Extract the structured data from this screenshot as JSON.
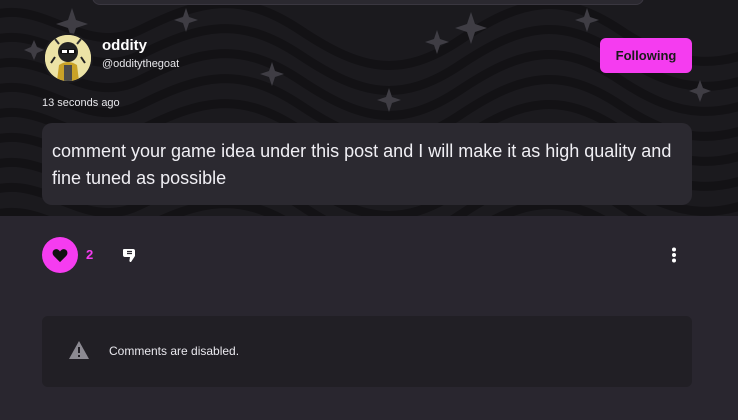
{
  "post": {
    "author": {
      "name": "oddity",
      "handle": "@odditythegoat",
      "avatar_icon": "goat-avatar"
    },
    "follow_label": "Following",
    "timestamp": "13 seconds ago",
    "body": "comment your game idea under this post and I will make it as high quality and fine tuned as possible"
  },
  "actions": {
    "like_count": "2",
    "like_icon": "heart-icon",
    "dislike_icon": "thumbs-down-icon",
    "more_icon": "more-vertical-icon"
  },
  "comments": {
    "disabled_message": "Comments are disabled.",
    "icon": "warning-icon"
  },
  "colors": {
    "accent": "#f53cf0",
    "page_bg": "#29262f",
    "banner_bg": "#1b1a1e",
    "card_bg": "#2b2930",
    "comments_bg": "#211f25"
  }
}
